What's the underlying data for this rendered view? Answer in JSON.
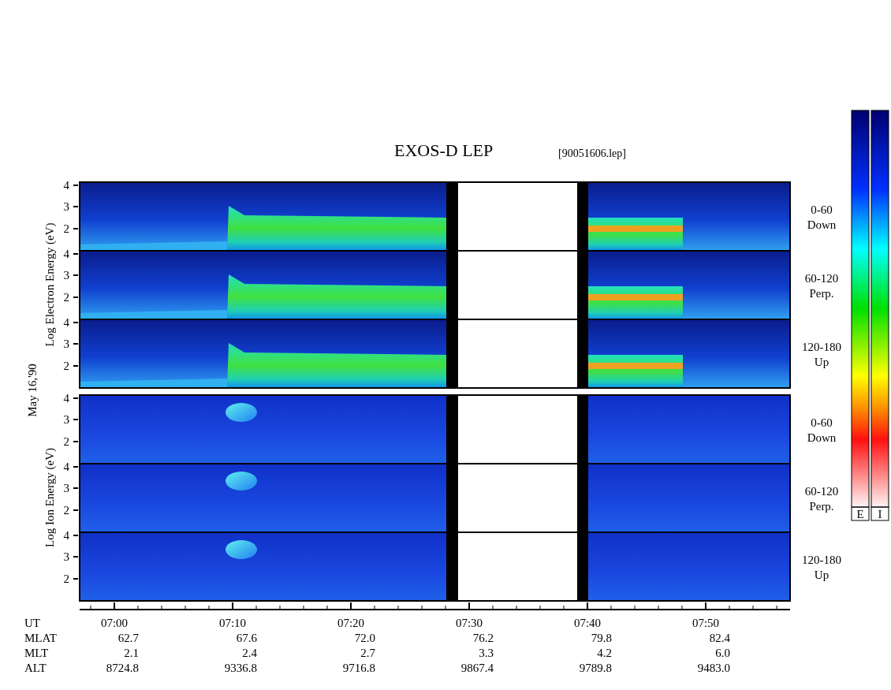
{
  "title": "EXOS-D LEP",
  "file": "[90051606.lep]",
  "date": "May 16,'90",
  "groups": [
    {
      "kind": "electron",
      "axis_label": "Log Electron Energy (eV)",
      "panels": [
        {
          "y_ticks": [
            "4",
            "3",
            "2"
          ],
          "angle": "0-60",
          "direction": "Down"
        },
        {
          "y_ticks": [
            "4",
            "3",
            "2"
          ],
          "angle": "60-120",
          "direction": "Perp."
        },
        {
          "y_ticks": [
            "4",
            "3",
            "2"
          ],
          "angle": "120-180",
          "direction": "Up"
        }
      ]
    },
    {
      "kind": "ion",
      "axis_label": "Log Ion Energy (eV)",
      "panels": [
        {
          "y_ticks": [
            "4",
            "3",
            "2"
          ],
          "angle": "0-60",
          "direction": "Down"
        },
        {
          "y_ticks": [
            "4",
            "3",
            "2"
          ],
          "angle": "60-120",
          "direction": "Perp."
        },
        {
          "y_ticks": [
            "4",
            "3",
            "2"
          ],
          "angle": "120-180",
          "direction": "Up"
        }
      ]
    }
  ],
  "time_axis": [
    {
      "label": "UT",
      "values": [
        "07:00",
        "07:10",
        "07:20",
        "07:30",
        "07:40",
        "07:50"
      ]
    },
    {
      "label": "MLAT",
      "values": [
        "62.7",
        "67.6",
        "72.0",
        "76.2",
        "79.8",
        "82.4"
      ]
    },
    {
      "label": "MLT",
      "values": [
        "2.1",
        "2.4",
        "2.7",
        "3.3",
        "4.2",
        "6.0"
      ]
    },
    {
      "label": "ALT",
      "values": [
        "8724.8",
        "9336.8",
        "9716.8",
        "9867.4",
        "9789.8",
        "9483.0"
      ]
    }
  ],
  "color_scales": [
    {
      "label": "E"
    },
    {
      "label": "I"
    }
  ]
}
